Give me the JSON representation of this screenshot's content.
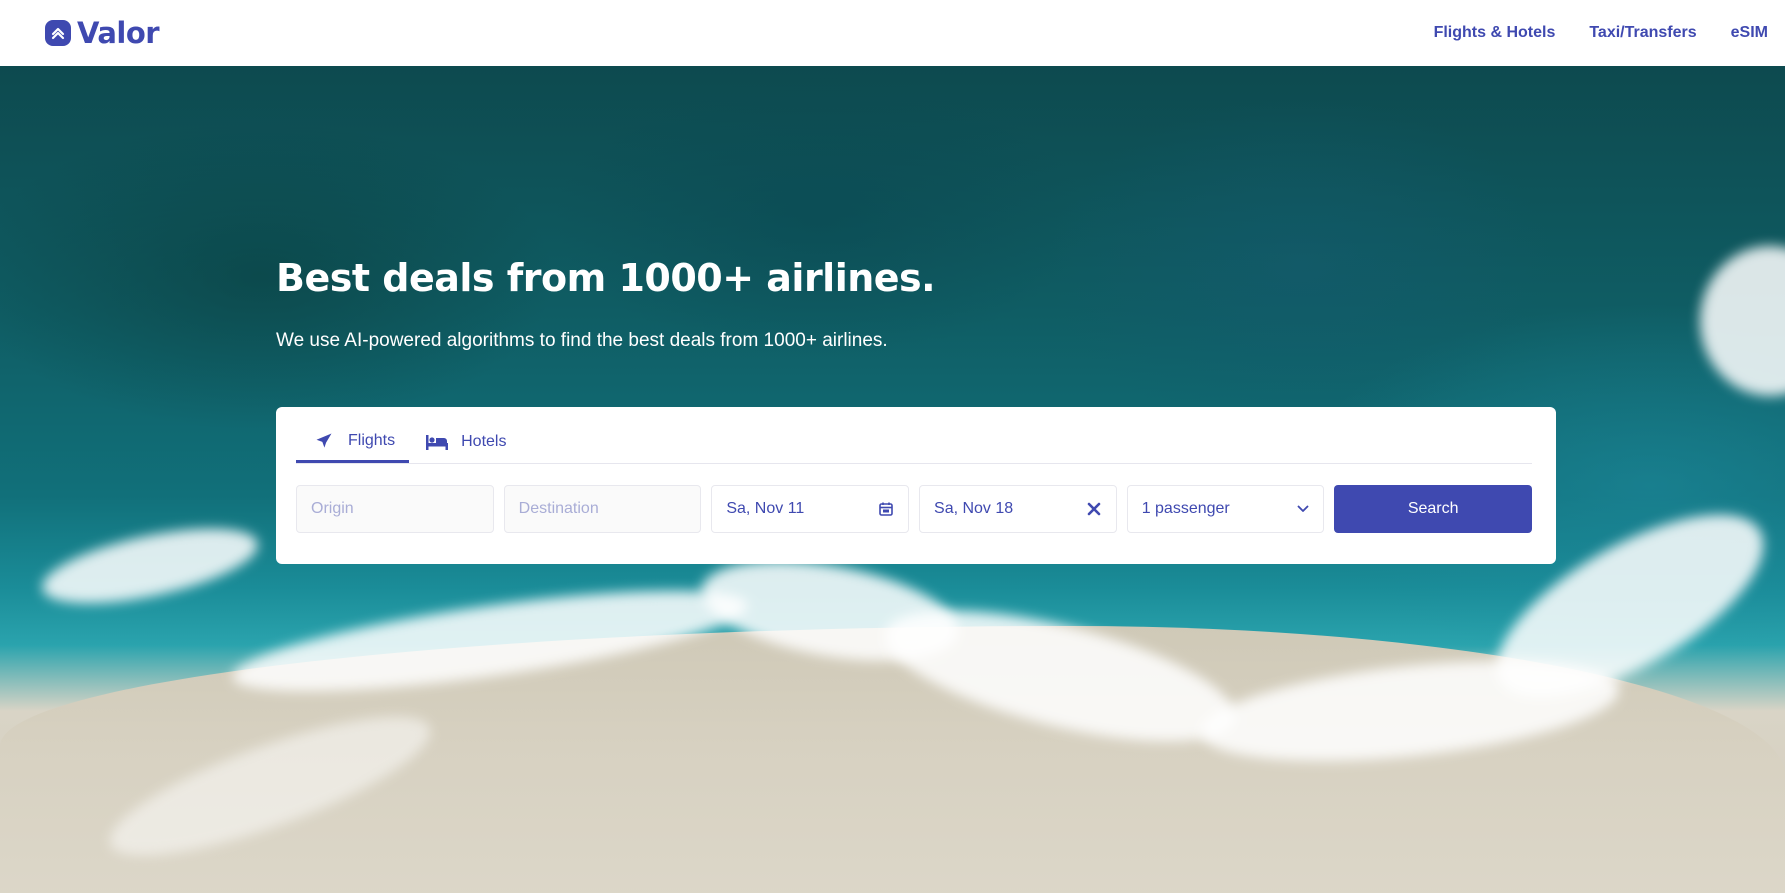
{
  "brand": {
    "name": "Valor",
    "color": "#3f49b0"
  },
  "nav": {
    "items": [
      {
        "label": "Flights & Hotels"
      },
      {
        "label": "Taxi/Transfers"
      },
      {
        "label": "eSIM"
      }
    ]
  },
  "hero": {
    "title": "Best deals from 1000+ airlines.",
    "subtitle": "We use AI-powered algorithms to find the best deals from 1000+ airlines."
  },
  "search": {
    "tabs": [
      {
        "label": "Flights",
        "icon": "airplane-icon",
        "active": true
      },
      {
        "label": "Hotels",
        "icon": "bed-icon",
        "active": false
      }
    ],
    "origin": {
      "placeholder": "Origin",
      "value": ""
    },
    "destination": {
      "placeholder": "Destination",
      "value": ""
    },
    "depart_date": {
      "value": "Sa, Nov 11",
      "icon": "calendar-icon"
    },
    "return_date": {
      "value": "Sa, Nov 18",
      "icon": "close-icon"
    },
    "passengers": {
      "value": "1 passenger",
      "icon": "chevron-down-icon"
    },
    "button_label": "Search"
  }
}
